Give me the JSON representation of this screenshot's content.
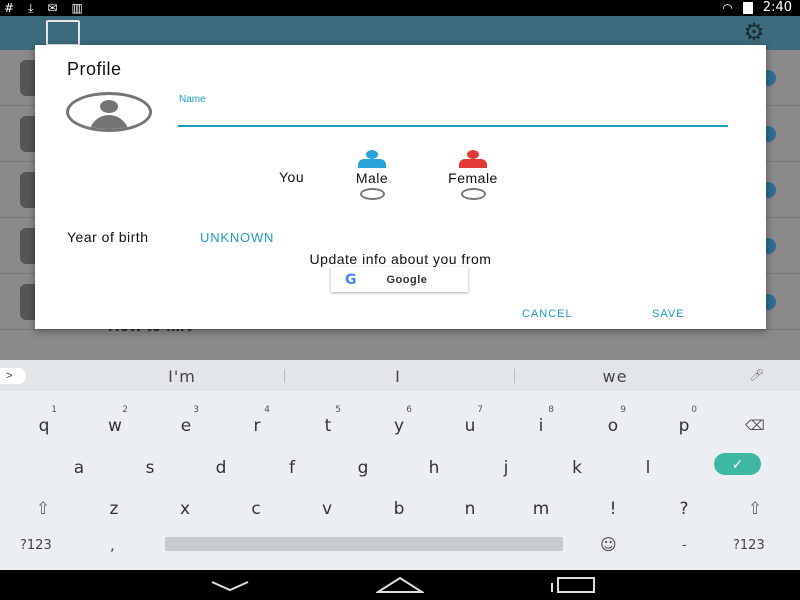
{
  "statusbar": {
    "left_icons": [
      "hash-icon",
      "download-icon",
      "mail-icon",
      "barcode-icon"
    ],
    "time": "2:40"
  },
  "dialog": {
    "title": "Profile",
    "name_label": "Name",
    "name_value": "",
    "you_label": "You",
    "male_label": "Male",
    "female_label": "Female",
    "male_color": "#29a3d8",
    "female_color": "#e53935",
    "yob_label": "Year of birth",
    "yob_value": "UNKNOWN",
    "update_text": "Update info about you from",
    "google_label": "Google",
    "cancel_label": "CANCEL",
    "save_label": "SAVE",
    "accent_color": "#1e9bc4"
  },
  "background_app": {
    "visible_title_fragment": "How to flirt"
  },
  "keyboard": {
    "suggestions": [
      "I'm",
      "I",
      "we"
    ],
    "row1": [
      {
        "ch": "q",
        "digit": "1"
      },
      {
        "ch": "w",
        "digit": "2"
      },
      {
        "ch": "e",
        "digit": "3"
      },
      {
        "ch": "r",
        "digit": "4"
      },
      {
        "ch": "t",
        "digit": "5"
      },
      {
        "ch": "y",
        "digit": "6"
      },
      {
        "ch": "u",
        "digit": "7"
      },
      {
        "ch": "i",
        "digit": "8"
      },
      {
        "ch": "o",
        "digit": "9"
      },
      {
        "ch": "p",
        "digit": "0"
      }
    ],
    "row2": [
      "a",
      "s",
      "d",
      "f",
      "g",
      "h",
      "j",
      "k",
      "l"
    ],
    "row3": [
      "z",
      "x",
      "c",
      "v",
      "b",
      "n",
      "m",
      "!",
      "?"
    ],
    "symbols_label": "?123",
    "comma_label": ",",
    "dash_label": "-",
    "emoji": "☺",
    "enter_color": "#3eb8a5"
  }
}
